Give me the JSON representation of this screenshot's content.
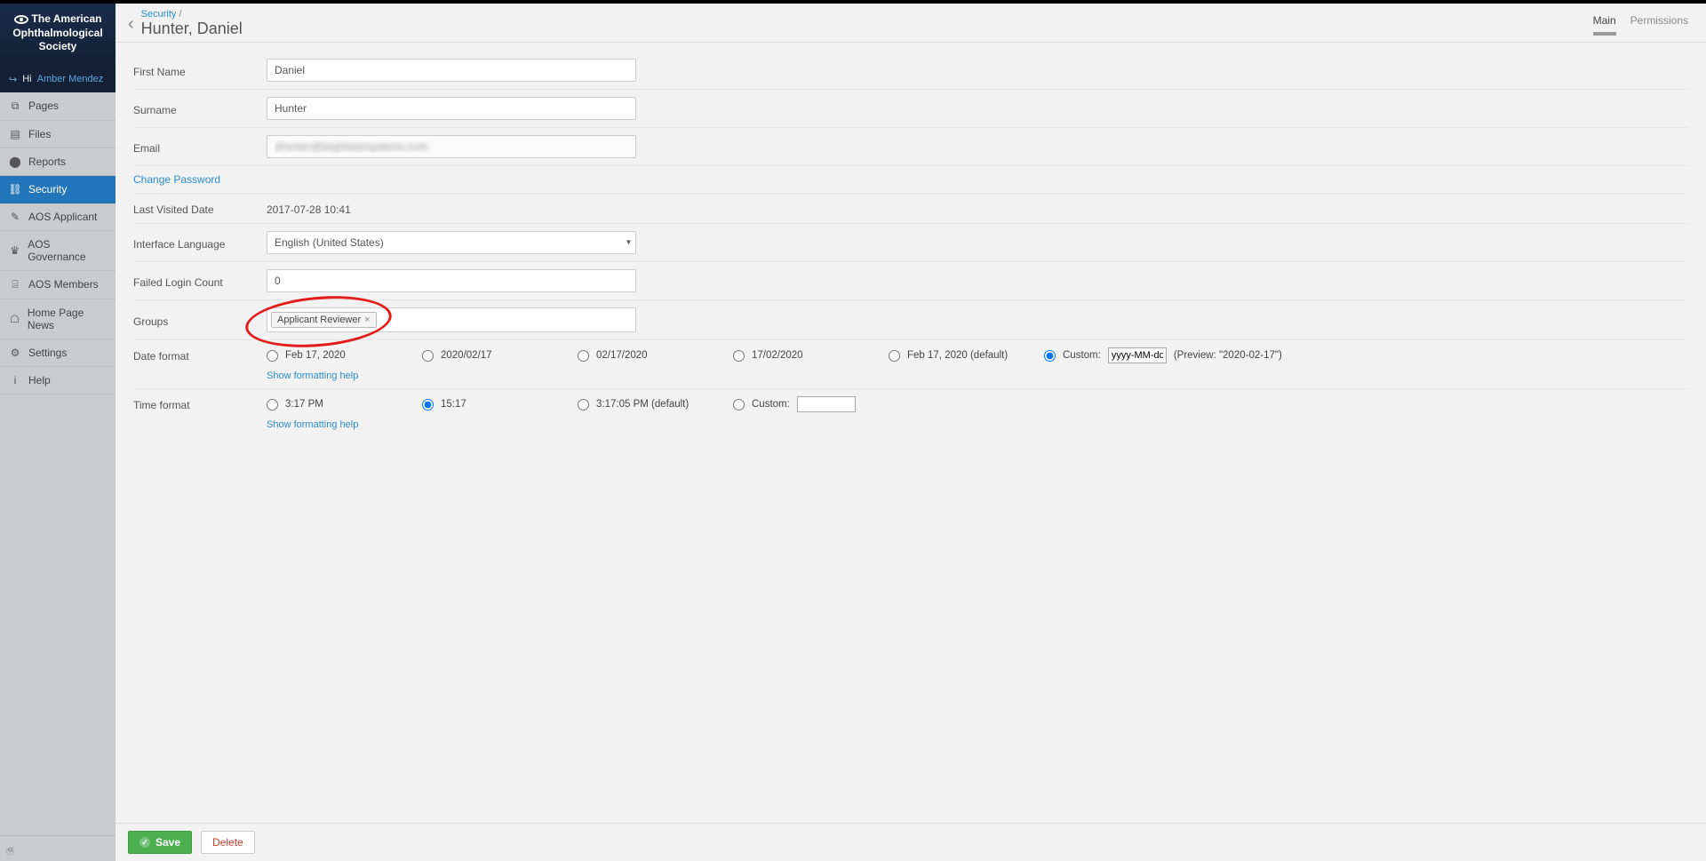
{
  "brand": {
    "line1": "The American",
    "line2": "Ophthalmological",
    "line3": "Society"
  },
  "user": {
    "greeting": "Hi",
    "name": "Amber Mendez"
  },
  "sidebar": {
    "items": [
      {
        "label": "Pages",
        "icon": "⧉",
        "active": false
      },
      {
        "label": "Files",
        "icon": "▤",
        "active": false
      },
      {
        "label": "Reports",
        "icon": "⬤",
        "active": false
      },
      {
        "label": "Security",
        "icon": "⛓",
        "active": true
      },
      {
        "label": "AOS Applicant",
        "icon": "✎",
        "active": false
      },
      {
        "label": "AOS Governance",
        "icon": "♛",
        "active": false
      },
      {
        "label": "AOS Members",
        "icon": "⌸",
        "active": false
      },
      {
        "label": "Home Page News",
        "icon": "☖",
        "active": false
      },
      {
        "label": "Settings",
        "icon": "⚙",
        "active": false
      },
      {
        "label": "Help",
        "icon": "i",
        "active": false
      }
    ]
  },
  "header": {
    "breadcrumb_root": "Security",
    "breadcrumb_sep": "/",
    "title": "Hunter, Daniel",
    "tabs": [
      {
        "label": "Main",
        "active": true
      },
      {
        "label": "Permissions",
        "active": false
      }
    ]
  },
  "form": {
    "first_name": {
      "label": "First Name",
      "value": "Daniel"
    },
    "surname": {
      "label": "Surname",
      "value": "Hunter"
    },
    "email": {
      "label": "Email",
      "value": "dhunter@brightstarsystems.com"
    },
    "change_password": "Change Password",
    "last_visited": {
      "label": "Last Visited Date",
      "value": "2017-07-28 10:41"
    },
    "interface_lang": {
      "label": "Interface Language",
      "value": "English (United States)"
    },
    "failed_login": {
      "label": "Failed Login Count",
      "value": "0"
    },
    "groups": {
      "label": "Groups",
      "tag": "Applicant Reviewer"
    },
    "date_format": {
      "label": "Date format",
      "options": [
        "Feb 17, 2020",
        "2020/02/17",
        "02/17/2020",
        "17/02/2020",
        "Feb 17, 2020 (default)"
      ],
      "custom_label": "Custom:",
      "custom_value": "yyyy-MM-dd",
      "custom_preview": "(Preview: \"2020-02-17\")",
      "selected_index": 5,
      "help": "Show formatting help"
    },
    "time_format": {
      "label": "Time format",
      "options": [
        "3:17 PM",
        "15:17",
        "3:17:05 PM (default)"
      ],
      "custom_label": "Custom:",
      "custom_value": "",
      "selected_index": 1,
      "help": "Show formatting help"
    }
  },
  "footer": {
    "save": "Save",
    "delete": "Delete"
  }
}
